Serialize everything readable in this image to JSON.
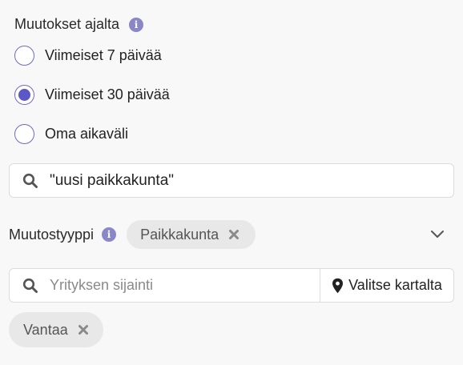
{
  "period": {
    "label": "Muutokset ajalta",
    "info_glyph": "i",
    "options": [
      {
        "label": "Viimeiset 7 päivää",
        "selected": false
      },
      {
        "label": "Viimeiset 30 päivää",
        "selected": true
      },
      {
        "label": "Oma aikaväli",
        "selected": false
      }
    ]
  },
  "search": {
    "value": "\"uusi paikkakunta\"",
    "icon": "search-icon"
  },
  "change_type": {
    "label": "Muutostyyppi",
    "info_glyph": "i",
    "chips": [
      {
        "label": "Paikkakunta"
      }
    ],
    "dropdown_icon": "chevron-down-icon"
  },
  "location": {
    "placeholder": "Yrityksen sijainti",
    "map_button": "Valitse kartalta",
    "chips": [
      {
        "label": "Vantaa"
      }
    ]
  },
  "colors": {
    "accent": "#5d58c8",
    "info_icon": "#8a87c9",
    "chip_bg": "#e8e8e8"
  }
}
